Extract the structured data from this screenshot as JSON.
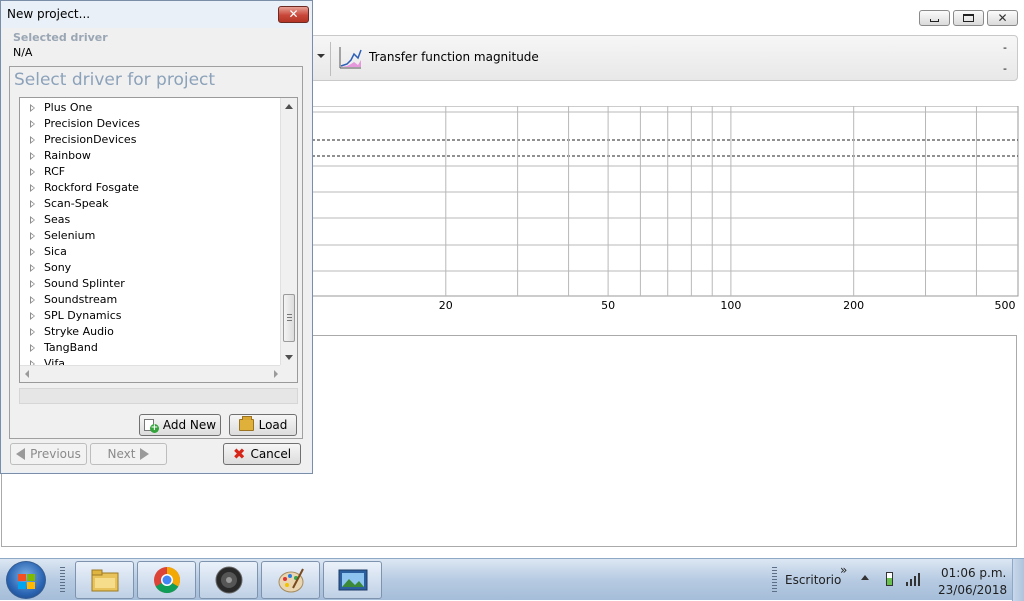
{
  "main_window": {
    "toolbar": {
      "chart_label": "Transfer function magnitude",
      "right_top": "-",
      "right_bottom": "-"
    },
    "plot": {
      "x_axis": {
        "scale": "log",
        "range": [
          10,
          500
        ],
        "tick_labels": [
          "20",
          "50",
          "100",
          "200",
          "500"
        ]
      },
      "grid": true
    }
  },
  "dialog": {
    "title": "New project...",
    "close_glyph": "✕",
    "selected_label": "Selected driver",
    "selected_value": "N/A",
    "heading": "Select driver for project",
    "drivers": [
      "Plus One",
      "Precision Devices",
      "PrecisionDevices",
      "Rainbow",
      "RCF",
      "Rockford Fosgate",
      "Scan-Speak",
      "Seas",
      "Selenium",
      "Sica",
      "Sony",
      "Sound Splinter",
      "Soundstream",
      "SPL Dynamics",
      "Stryke Audio",
      "TangBand",
      "Vifa"
    ],
    "buttons": {
      "add_new": "Add New",
      "load": "Load",
      "previous": "Previous",
      "next": "Next",
      "cancel": "Cancel"
    }
  },
  "taskbar": {
    "apps": [
      {
        "name": "Windows Explorer",
        "icon": "folder-icon"
      },
      {
        "name": "Google Chrome",
        "icon": "chrome-icon"
      },
      {
        "name": "Speaker design app",
        "icon": "speaker-icon"
      },
      {
        "name": "Paint",
        "icon": "paint-palette-icon"
      },
      {
        "name": "Photo viewer",
        "icon": "picture-icon"
      }
    ],
    "desktop_label": "Escritorio",
    "tray_chevron": "»",
    "time": "01:06 p.m.",
    "date": "23/06/2018"
  }
}
